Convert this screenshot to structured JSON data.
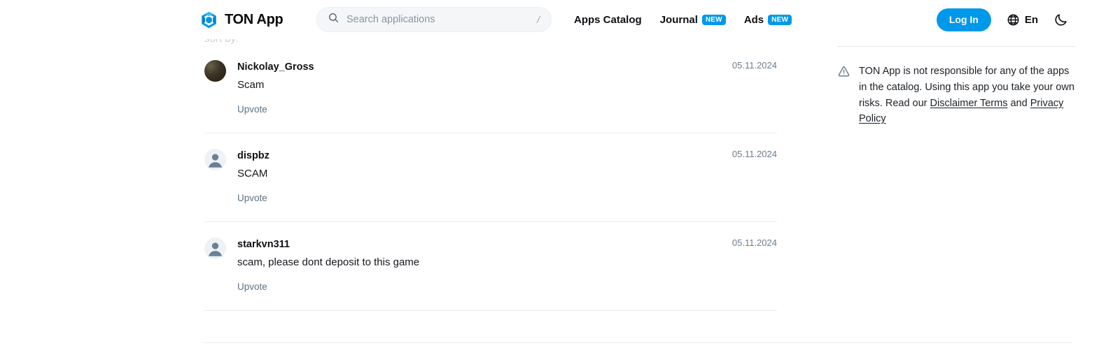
{
  "header": {
    "brand_name": "TON App",
    "brand_logo_icon": "ton-gem-icon",
    "search": {
      "placeholder": "Search applications",
      "value": "",
      "icon": "search-icon",
      "shortcut_hint": "/"
    },
    "nav": [
      {
        "label": "Apps Catalog",
        "badge": ""
      },
      {
        "label": "Journal",
        "badge": "NEW"
      },
      {
        "label": "Ads",
        "badge": "NEW"
      }
    ],
    "login_label": "Log In",
    "language": {
      "label": "En",
      "icon": "globe-icon"
    },
    "theme_toggle_icon": "moon-icon",
    "accent_color": "#0098ea"
  },
  "reviews": {
    "clipped_row_text": "sort by:",
    "upvote_label": "Upvote",
    "items": [
      {
        "author": "Nickolay_Gross",
        "text": "Scam",
        "date": "05.11.2024",
        "avatar_type": "photo"
      },
      {
        "author": "dispbz",
        "text": "SCAM",
        "date": "05.11.2024",
        "avatar_type": "default"
      },
      {
        "author": "starkvn311",
        "text": "scam, please dont deposit to this game",
        "date": "05.11.2024",
        "avatar_type": "default"
      }
    ]
  },
  "sidebar": {
    "warning_icon": "warning-triangle-icon",
    "disclaimer": {
      "part1": "TON App is not responsible for any of the apps in the catalog. Using this app you take your own risks. Read our ",
      "link1": "Disclaimer Terms",
      "part2": " and ",
      "link2": "Privacy Policy"
    }
  }
}
